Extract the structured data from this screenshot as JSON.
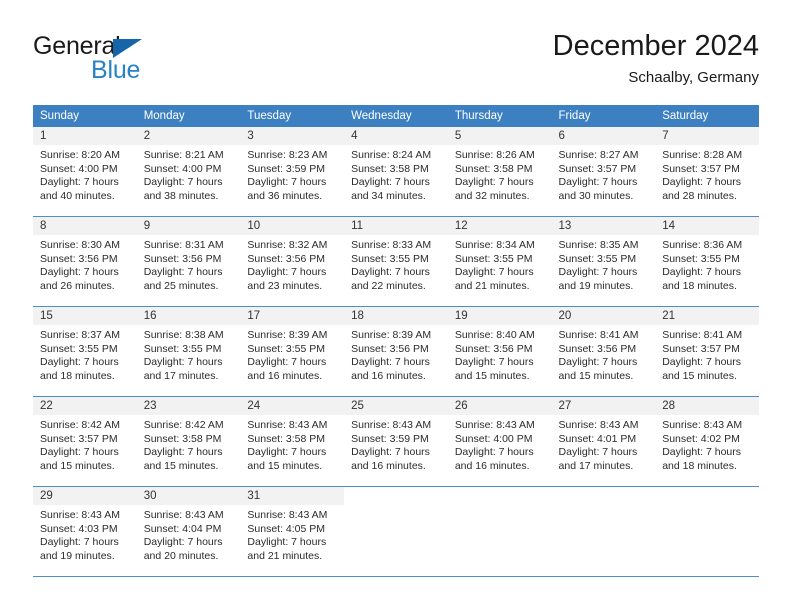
{
  "brand": {
    "name_part1": "General",
    "name_part2": "Blue",
    "triangle_icon": "triangle-icon",
    "colors": {
      "general_text": "#1a1a1a",
      "blue_text": "#2683c6",
      "triangle": "#1565a8"
    }
  },
  "header": {
    "title": "December 2024",
    "subtitle": "Schaalby, Germany"
  },
  "calendar": {
    "accent_color": "#3d80c2",
    "grid_line_color": "#4a90cc",
    "date_strip_color": "#f2f2f2",
    "weekday_headers": [
      "Sunday",
      "Monday",
      "Tuesday",
      "Wednesday",
      "Thursday",
      "Friday",
      "Saturday"
    ],
    "weeks": [
      [
        {
          "day": "1",
          "sunrise": "Sunrise: 8:20 AM",
          "sunset": "Sunset: 4:00 PM",
          "daylight_line1": "Daylight: 7 hours",
          "daylight_line2": "and 40 minutes."
        },
        {
          "day": "2",
          "sunrise": "Sunrise: 8:21 AM",
          "sunset": "Sunset: 4:00 PM",
          "daylight_line1": "Daylight: 7 hours",
          "daylight_line2": "and 38 minutes."
        },
        {
          "day": "3",
          "sunrise": "Sunrise: 8:23 AM",
          "sunset": "Sunset: 3:59 PM",
          "daylight_line1": "Daylight: 7 hours",
          "daylight_line2": "and 36 minutes."
        },
        {
          "day": "4",
          "sunrise": "Sunrise: 8:24 AM",
          "sunset": "Sunset: 3:58 PM",
          "daylight_line1": "Daylight: 7 hours",
          "daylight_line2": "and 34 minutes."
        },
        {
          "day": "5",
          "sunrise": "Sunrise: 8:26 AM",
          "sunset": "Sunset: 3:58 PM",
          "daylight_line1": "Daylight: 7 hours",
          "daylight_line2": "and 32 minutes."
        },
        {
          "day": "6",
          "sunrise": "Sunrise: 8:27 AM",
          "sunset": "Sunset: 3:57 PM",
          "daylight_line1": "Daylight: 7 hours",
          "daylight_line2": "and 30 minutes."
        },
        {
          "day": "7",
          "sunrise": "Sunrise: 8:28 AM",
          "sunset": "Sunset: 3:57 PM",
          "daylight_line1": "Daylight: 7 hours",
          "daylight_line2": "and 28 minutes."
        }
      ],
      [
        {
          "day": "8",
          "sunrise": "Sunrise: 8:30 AM",
          "sunset": "Sunset: 3:56 PM",
          "daylight_line1": "Daylight: 7 hours",
          "daylight_line2": "and 26 minutes."
        },
        {
          "day": "9",
          "sunrise": "Sunrise: 8:31 AM",
          "sunset": "Sunset: 3:56 PM",
          "daylight_line1": "Daylight: 7 hours",
          "daylight_line2": "and 25 minutes."
        },
        {
          "day": "10",
          "sunrise": "Sunrise: 8:32 AM",
          "sunset": "Sunset: 3:56 PM",
          "daylight_line1": "Daylight: 7 hours",
          "daylight_line2": "and 23 minutes."
        },
        {
          "day": "11",
          "sunrise": "Sunrise: 8:33 AM",
          "sunset": "Sunset: 3:55 PM",
          "daylight_line1": "Daylight: 7 hours",
          "daylight_line2": "and 22 minutes."
        },
        {
          "day": "12",
          "sunrise": "Sunrise: 8:34 AM",
          "sunset": "Sunset: 3:55 PM",
          "daylight_line1": "Daylight: 7 hours",
          "daylight_line2": "and 21 minutes."
        },
        {
          "day": "13",
          "sunrise": "Sunrise: 8:35 AM",
          "sunset": "Sunset: 3:55 PM",
          "daylight_line1": "Daylight: 7 hours",
          "daylight_line2": "and 19 minutes."
        },
        {
          "day": "14",
          "sunrise": "Sunrise: 8:36 AM",
          "sunset": "Sunset: 3:55 PM",
          "daylight_line1": "Daylight: 7 hours",
          "daylight_line2": "and 18 minutes."
        }
      ],
      [
        {
          "day": "15",
          "sunrise": "Sunrise: 8:37 AM",
          "sunset": "Sunset: 3:55 PM",
          "daylight_line1": "Daylight: 7 hours",
          "daylight_line2": "and 18 minutes."
        },
        {
          "day": "16",
          "sunrise": "Sunrise: 8:38 AM",
          "sunset": "Sunset: 3:55 PM",
          "daylight_line1": "Daylight: 7 hours",
          "daylight_line2": "and 17 minutes."
        },
        {
          "day": "17",
          "sunrise": "Sunrise: 8:39 AM",
          "sunset": "Sunset: 3:55 PM",
          "daylight_line1": "Daylight: 7 hours",
          "daylight_line2": "and 16 minutes."
        },
        {
          "day": "18",
          "sunrise": "Sunrise: 8:39 AM",
          "sunset": "Sunset: 3:56 PM",
          "daylight_line1": "Daylight: 7 hours",
          "daylight_line2": "and 16 minutes."
        },
        {
          "day": "19",
          "sunrise": "Sunrise: 8:40 AM",
          "sunset": "Sunset: 3:56 PM",
          "daylight_line1": "Daylight: 7 hours",
          "daylight_line2": "and 15 minutes."
        },
        {
          "day": "20",
          "sunrise": "Sunrise: 8:41 AM",
          "sunset": "Sunset: 3:56 PM",
          "daylight_line1": "Daylight: 7 hours",
          "daylight_line2": "and 15 minutes."
        },
        {
          "day": "21",
          "sunrise": "Sunrise: 8:41 AM",
          "sunset": "Sunset: 3:57 PM",
          "daylight_line1": "Daylight: 7 hours",
          "daylight_line2": "and 15 minutes."
        }
      ],
      [
        {
          "day": "22",
          "sunrise": "Sunrise: 8:42 AM",
          "sunset": "Sunset: 3:57 PM",
          "daylight_line1": "Daylight: 7 hours",
          "daylight_line2": "and 15 minutes."
        },
        {
          "day": "23",
          "sunrise": "Sunrise: 8:42 AM",
          "sunset": "Sunset: 3:58 PM",
          "daylight_line1": "Daylight: 7 hours",
          "daylight_line2": "and 15 minutes."
        },
        {
          "day": "24",
          "sunrise": "Sunrise: 8:43 AM",
          "sunset": "Sunset: 3:58 PM",
          "daylight_line1": "Daylight: 7 hours",
          "daylight_line2": "and 15 minutes."
        },
        {
          "day": "25",
          "sunrise": "Sunrise: 8:43 AM",
          "sunset": "Sunset: 3:59 PM",
          "daylight_line1": "Daylight: 7 hours",
          "daylight_line2": "and 16 minutes."
        },
        {
          "day": "26",
          "sunrise": "Sunrise: 8:43 AM",
          "sunset": "Sunset: 4:00 PM",
          "daylight_line1": "Daylight: 7 hours",
          "daylight_line2": "and 16 minutes."
        },
        {
          "day": "27",
          "sunrise": "Sunrise: 8:43 AM",
          "sunset": "Sunset: 4:01 PM",
          "daylight_line1": "Daylight: 7 hours",
          "daylight_line2": "and 17 minutes."
        },
        {
          "day": "28",
          "sunrise": "Sunrise: 8:43 AM",
          "sunset": "Sunset: 4:02 PM",
          "daylight_line1": "Daylight: 7 hours",
          "daylight_line2": "and 18 minutes."
        }
      ],
      [
        {
          "day": "29",
          "sunrise": "Sunrise: 8:43 AM",
          "sunset": "Sunset: 4:03 PM",
          "daylight_line1": "Daylight: 7 hours",
          "daylight_line2": "and 19 minutes."
        },
        {
          "day": "30",
          "sunrise": "Sunrise: 8:43 AM",
          "sunset": "Sunset: 4:04 PM",
          "daylight_line1": "Daylight: 7 hours",
          "daylight_line2": "and 20 minutes."
        },
        {
          "day": "31",
          "sunrise": "Sunrise: 8:43 AM",
          "sunset": "Sunset: 4:05 PM",
          "daylight_line1": "Daylight: 7 hours",
          "daylight_line2": "and 21 minutes."
        },
        {
          "day": "",
          "sunrise": "",
          "sunset": "",
          "daylight_line1": "",
          "daylight_line2": ""
        },
        {
          "day": "",
          "sunrise": "",
          "sunset": "",
          "daylight_line1": "",
          "daylight_line2": ""
        },
        {
          "day": "",
          "sunrise": "",
          "sunset": "",
          "daylight_line1": "",
          "daylight_line2": ""
        },
        {
          "day": "",
          "sunrise": "",
          "sunset": "",
          "daylight_line1": "",
          "daylight_line2": ""
        }
      ]
    ]
  }
}
